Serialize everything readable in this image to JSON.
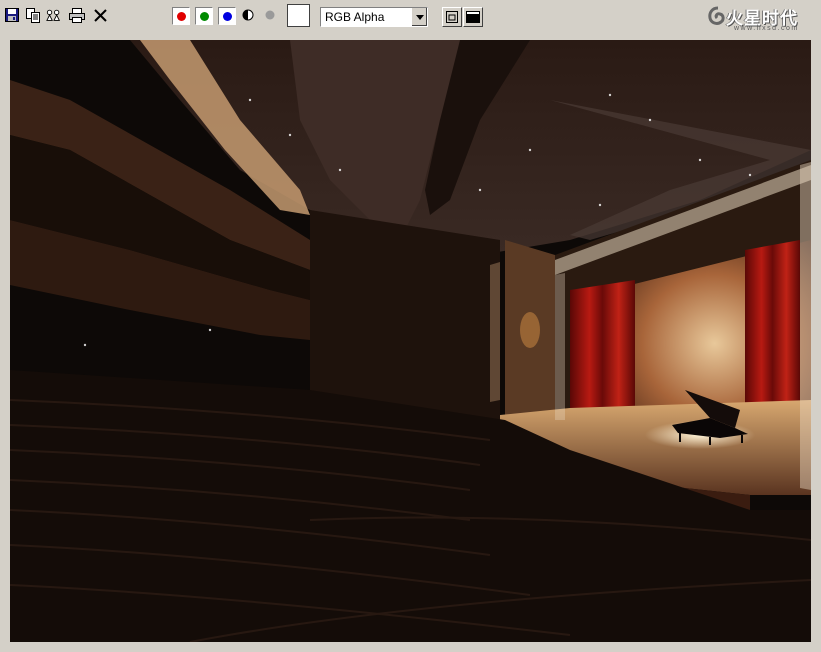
{
  "window": {
    "background": "#d4d0c8"
  },
  "toolbar": {
    "left_icons": [
      "save-icon",
      "copy-icon",
      "clone-icon",
      "print-icon",
      "clear-icon"
    ],
    "channels": [
      {
        "name": "red",
        "color": "#e00000"
      },
      {
        "name": "green",
        "color": "#008a00"
      },
      {
        "name": "blue",
        "color": "#0000e0"
      }
    ],
    "display_select": {
      "value": "RGB Alpha"
    },
    "swatch_color": "#ffffff"
  },
  "logo": {
    "title": "火星时代",
    "url": "www.hxsd.com"
  },
  "viewport": {
    "description_icon": "render-image",
    "dominant_colors": [
      "#0d0907",
      "#3a2418",
      "#8a5634",
      "#b81a12",
      "#f0d4a0"
    ]
  }
}
